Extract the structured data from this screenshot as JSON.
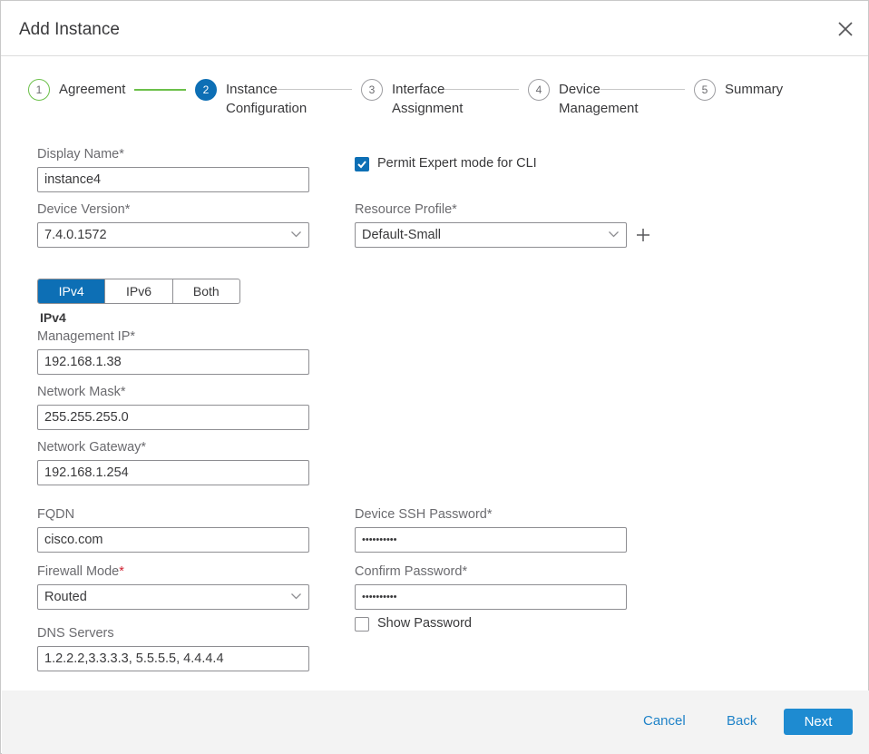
{
  "dialog": {
    "title": "Add Instance"
  },
  "wizard": {
    "steps": [
      {
        "num": "1",
        "label_line1": "Agreement",
        "label_line2": ""
      },
      {
        "num": "2",
        "label_line1": "Instance",
        "label_line2": "Configuration"
      },
      {
        "num": "3",
        "label_line1": "Interface",
        "label_line2": "Assignment"
      },
      {
        "num": "4",
        "label_line1": "Device",
        "label_line2": "Management"
      },
      {
        "num": "5",
        "label_line1": "Summary",
        "label_line2": ""
      }
    ],
    "current_step": 2
  },
  "form": {
    "display_name": {
      "label": "Display Name*",
      "value": "instance4"
    },
    "expert_mode": {
      "label": "Permit Expert mode for CLI",
      "checked": true
    },
    "device_version": {
      "label": "Device Version*",
      "value": "7.4.0.1572"
    },
    "resource_profile": {
      "label": "Resource Profile*",
      "value": "Default-Small"
    },
    "ip_mode": {
      "options": [
        "IPv4",
        "IPv6",
        "Both"
      ],
      "selected": "IPv4"
    },
    "ipv4_section": "IPv4",
    "management_ip": {
      "label": "Management IP*",
      "value": "192.168.1.38"
    },
    "network_mask": {
      "label": "Network Mask*",
      "value": "255.255.255.0"
    },
    "network_gateway": {
      "label": "Network Gateway*",
      "value": "192.168.1.254"
    },
    "fqdn": {
      "label": "FQDN",
      "value": "cisco.com"
    },
    "ssh_password": {
      "label": "Device SSH Password*",
      "value": "••••••••••"
    },
    "firewall_mode": {
      "label": "Firewall Mode",
      "required_mark": "*",
      "value": "Routed"
    },
    "confirm_password": {
      "label": "Confirm Password*",
      "value": "••••••••••"
    },
    "show_password": {
      "label": "Show Password",
      "checked": false
    },
    "dns_servers": {
      "label": "DNS Servers",
      "value": "1.2.2.2,3.3.3.3, 5.5.5.5,  4.4.4.4"
    }
  },
  "footer": {
    "cancel": "Cancel",
    "back": "Back",
    "next": "Next"
  },
  "colors": {
    "primary": "#0d6fb5",
    "link": "#1e82c8",
    "done": "#6cc04a",
    "required": "#cf2030"
  }
}
